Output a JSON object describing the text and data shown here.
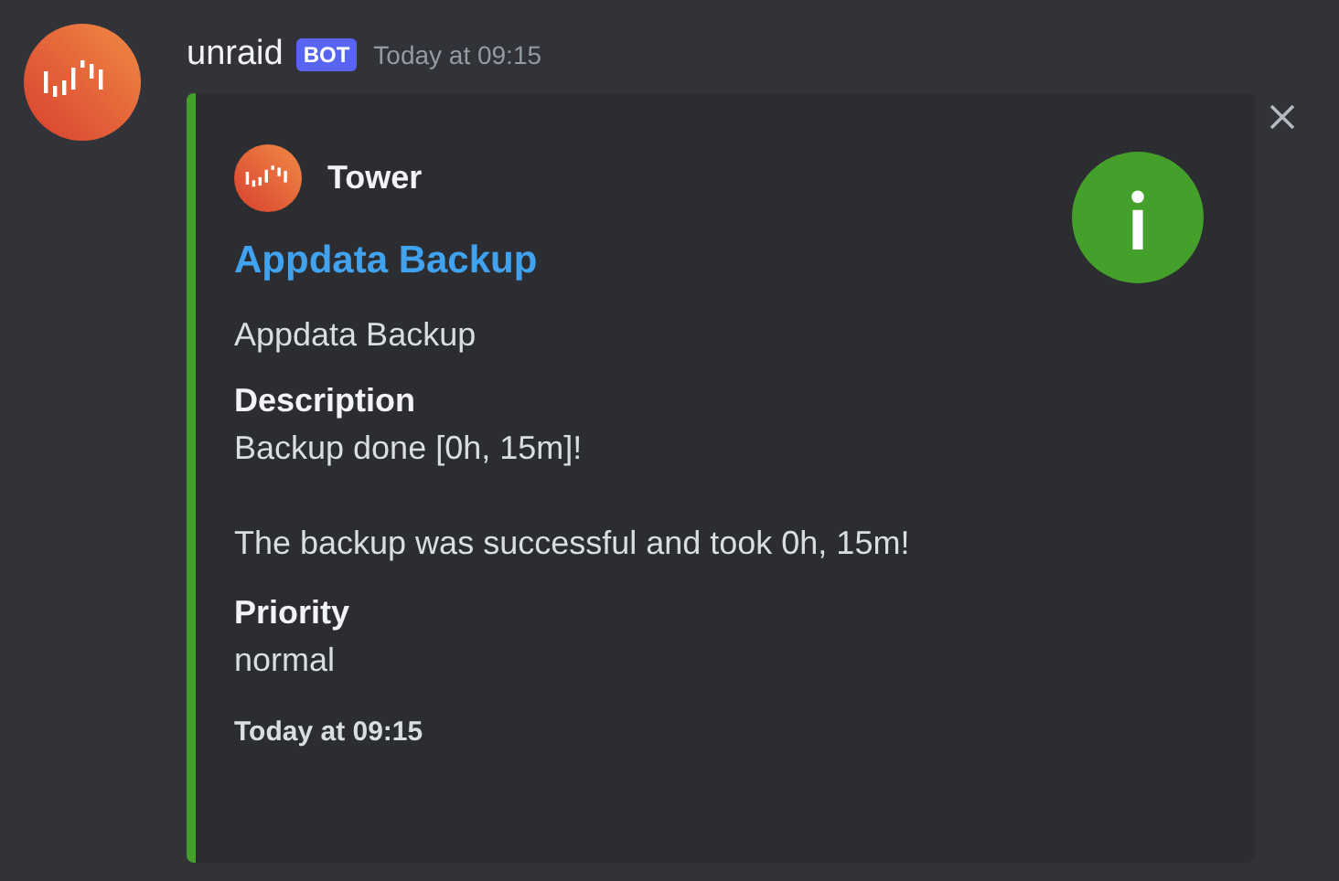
{
  "message": {
    "author": "unraid",
    "badge": "BOT",
    "timestamp": "Today at 09:15"
  },
  "embed": {
    "color": "#45a02b",
    "author": "Tower",
    "title": "Appdata Backup",
    "description": "Appdata Backup",
    "fields": [
      {
        "name": "Description",
        "value": "Backup done [0h, 15m]!\n\nThe backup was successful and took 0h, 15m!"
      },
      {
        "name": "Priority",
        "value": "normal"
      }
    ],
    "footer": "Today at 09:15"
  }
}
